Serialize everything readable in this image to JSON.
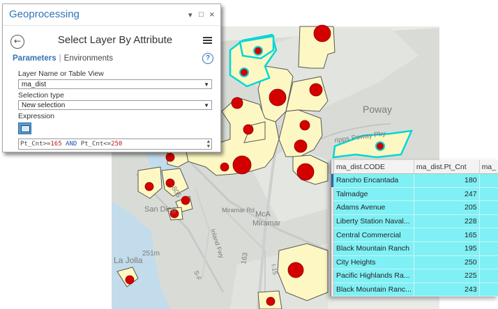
{
  "geoprocessing": {
    "title": "Geoprocessing",
    "window_controls": [
      "▾",
      "□",
      "×"
    ],
    "tool_title": "Select Layer By Attribute",
    "tabs": {
      "parameters": "Parameters",
      "environments": "Environments"
    },
    "layer_label": "Layer Name or Table View",
    "layer_value": "ma_dist",
    "selection_type_label": "Selection type",
    "selection_type_value": "New selection",
    "expression_label": "Expression",
    "expression": {
      "field1": "Pt_Cnt",
      "op1": ">=",
      "val1": "165",
      "conj": "AND",
      "field2": "Pt_Cnt",
      "op2": "<=",
      "val2": "250"
    }
  },
  "map": {
    "labels": {
      "poway": "Poway",
      "scripps_poway": "ripps Poway Pky",
      "miramar": "Miramar Rd",
      "san_diego": "San Dieg",
      "mca": "McA",
      "mca2": "Miramar",
      "la_jolla": "La Jolla",
      "i805": "805",
      "i163": "163",
      "elev251": "251m",
      "i15": "I-15",
      "inland_fwy": "Inland Fwy",
      "sf": "S-F"
    }
  },
  "attribute_table": {
    "columns": [
      "ma_dist.CODE",
      "ma_dist.Pt_Cnt",
      "ma_"
    ],
    "rows": [
      {
        "code": "Rancho Encantada",
        "pt_cnt": "180"
      },
      {
        "code": "Talmadge",
        "pt_cnt": "247"
      },
      {
        "code": "Adams Avenue",
        "pt_cnt": "205"
      },
      {
        "code": "Liberty Station Naval...",
        "pt_cnt": "228"
      },
      {
        "code": "Central Commercial",
        "pt_cnt": "165"
      },
      {
        "code": "Black Mountain Ranch",
        "pt_cnt": "195"
      },
      {
        "code": "City Heights",
        "pt_cnt": "250"
      },
      {
        "code": "Pacific Highlands Ra...",
        "pt_cnt": "225"
      },
      {
        "code": "Black Mountain Ranc...",
        "pt_cnt": "243"
      }
    ]
  },
  "colors": {
    "district_fill": "#fdf8c3",
    "district_selected": "#00dddd",
    "point": "#d40000",
    "selection_row": "#7ff0f5",
    "accent": "#2f74b5"
  }
}
